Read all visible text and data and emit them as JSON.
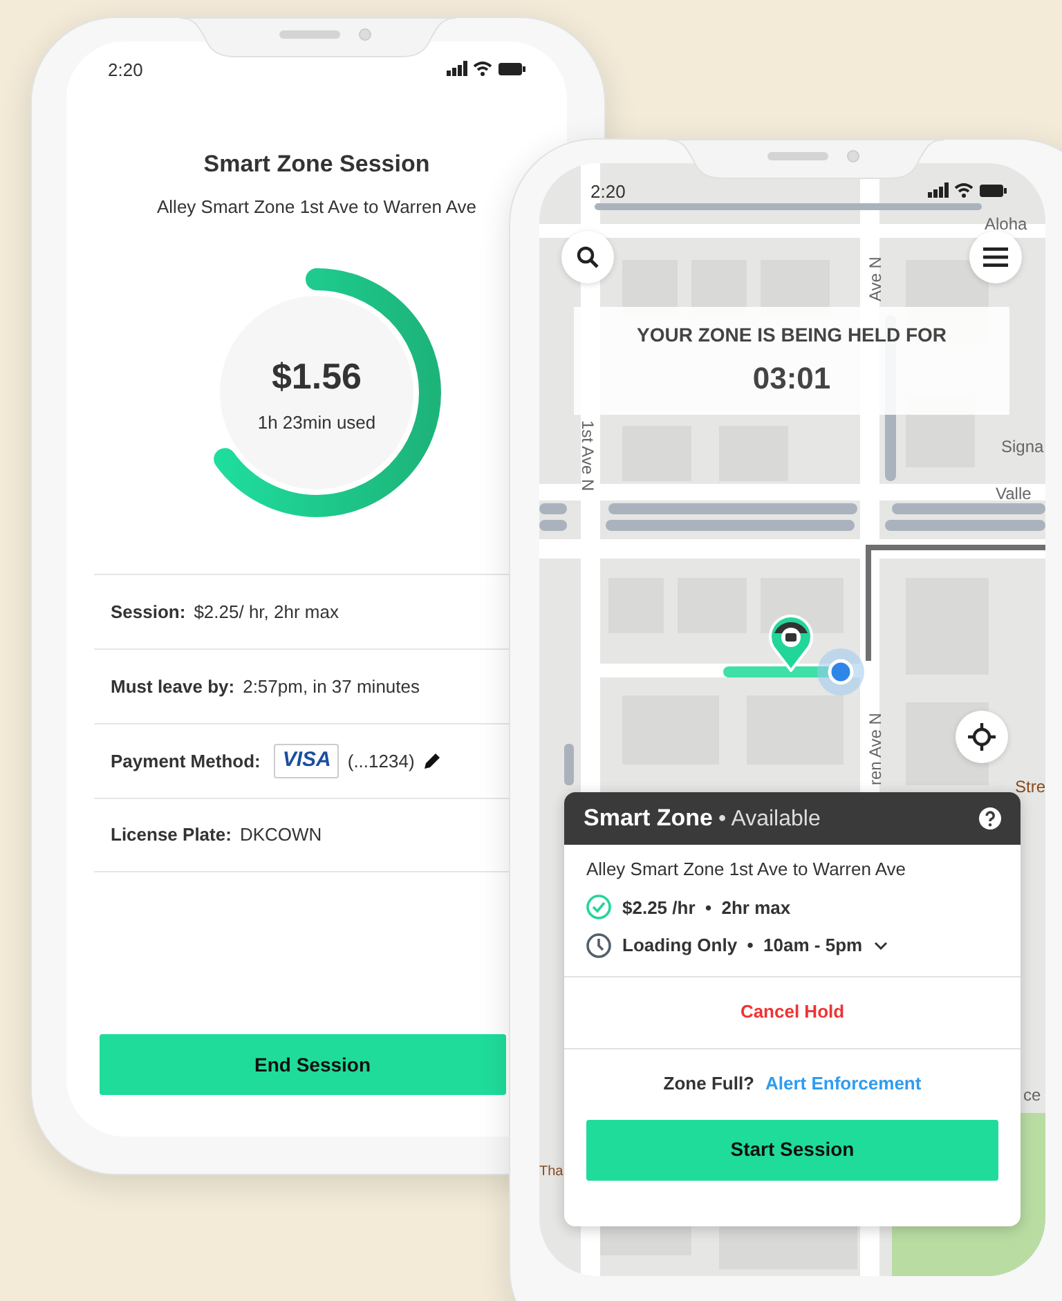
{
  "session_screen": {
    "status_time": "2:20",
    "title": "Smart Zone Session",
    "subtitle": "Alley Smart Zone 1st Ave to Warren Ave",
    "ring": {
      "amount": "$1.56",
      "used": "1h 23min used",
      "level": 0.65
    },
    "details": [
      {
        "label": "Session:",
        "value": "$2.25/ hr, 2hr max"
      },
      {
        "label": "Must leave by:",
        "value": "2:57pm, in 37 minutes"
      },
      {
        "label": "Payment Method:",
        "card_brand": "VISA",
        "value": "(...1234)",
        "editable": true
      },
      {
        "label": "License Plate:",
        "value": "DKCOWN"
      }
    ],
    "button": "End Session"
  },
  "map_screen": {
    "status_time": "2:20",
    "map_labels": [
      {
        "text": "Aloha"
      },
      {
        "text": "Ave N"
      },
      {
        "text": "1st Ave N"
      },
      {
        "text": "Signa"
      },
      {
        "text": "Valle"
      },
      {
        "text": "ren Ave N"
      },
      {
        "text": "Stre"
      },
      {
        "text": "ce"
      },
      {
        "text": "Tha"
      }
    ],
    "hold_banner": {
      "title": "YOUR ZONE IS BEING HELD FOR",
      "timer": "03:01"
    },
    "zone_card": {
      "title": "Smart Zone",
      "status": "• Available",
      "location": "Alley Smart Zone 1st Ave to Warren Ave",
      "features": [
        {
          "kind": "rate",
          "text": "$2.25 /hr  •  2hr max",
          "expandable": false
        },
        {
          "kind": "hours",
          "text": "Loading Only  •  10am - 5pm",
          "expandable": true
        }
      ],
      "cancel": "Cancel Hold",
      "prompt": "Zone Full?",
      "link": "Alert Enforcement",
      "button": "Start Session"
    }
  }
}
